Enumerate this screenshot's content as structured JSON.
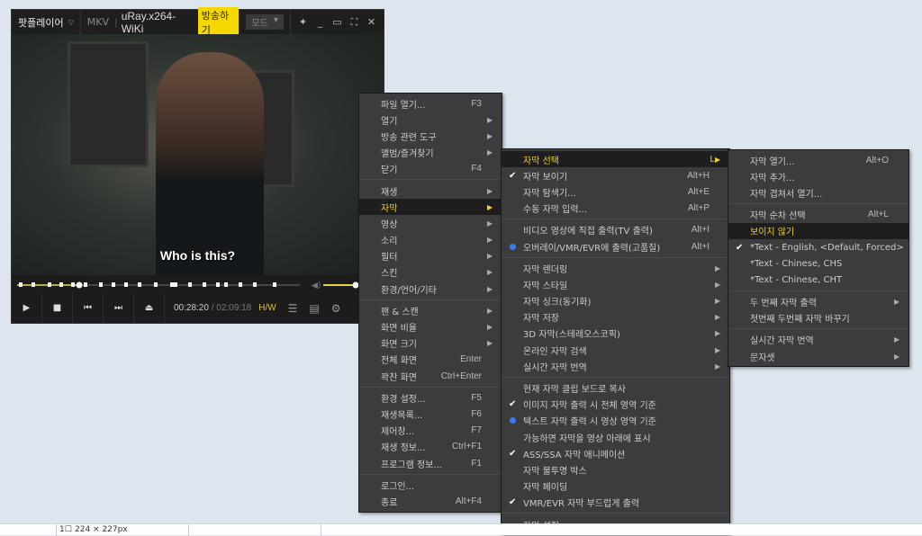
{
  "player": {
    "app_name": "팟플레이어",
    "format": "MKV",
    "file_name": "uRay.x264-WiKi",
    "broadcast_label": "방송하기",
    "mode_label": "모드",
    "subtitle_text": "Who is this?",
    "time_current": "00:28:20",
    "time_separator": "/",
    "time_total": "02:09:18",
    "hw_label": "H/W",
    "progress": 0.22,
    "volume": 1.0
  },
  "menu_main": [
    {
      "label": "파일 열기...",
      "shortcut": "F3"
    },
    {
      "label": "열기",
      "submenu": true
    },
    {
      "label": "방송 관련 도구",
      "submenu": true
    },
    {
      "label": "앨범/즐겨찾기",
      "submenu": true
    },
    {
      "label": "닫기",
      "shortcut": "F4"
    },
    {
      "sep": true
    },
    {
      "label": "재생",
      "submenu": true
    },
    {
      "label": "자막",
      "submenu": true,
      "selected": true
    },
    {
      "label": "영상",
      "submenu": true
    },
    {
      "label": "소리",
      "submenu": true
    },
    {
      "label": "필터",
      "submenu": true
    },
    {
      "label": "스킨",
      "submenu": true
    },
    {
      "label": "환경/언어/기타",
      "submenu": true
    },
    {
      "sep": true
    },
    {
      "label": "팬 & 스캔",
      "submenu": true
    },
    {
      "label": "화면 비율",
      "submenu": true
    },
    {
      "label": "화면 크기",
      "submenu": true
    },
    {
      "label": "전체 화면",
      "shortcut": "Enter"
    },
    {
      "label": "꽉찬 화면",
      "shortcut": "Ctrl+Enter"
    },
    {
      "sep": true
    },
    {
      "label": "환경 설정...",
      "shortcut": "F5"
    },
    {
      "label": "재생목록...",
      "shortcut": "F6"
    },
    {
      "label": "제어창...",
      "shortcut": "F7"
    },
    {
      "label": "재생 정보...",
      "shortcut": "Ctrl+F1"
    },
    {
      "label": "프로그램 정보...",
      "shortcut": "F1"
    },
    {
      "sep": true
    },
    {
      "label": "로그인..."
    },
    {
      "label": "종료",
      "shortcut": "Alt+F4"
    }
  ],
  "menu_subtitle": [
    {
      "label": "자막 선택",
      "shortcut": "L",
      "submenu": true,
      "selected": true
    },
    {
      "label": "자막 보이기",
      "shortcut": "Alt+H",
      "check": true
    },
    {
      "label": "자막 탐색기...",
      "shortcut": "Alt+E"
    },
    {
      "label": "수동 자막 입력...",
      "shortcut": "Alt+P"
    },
    {
      "sep": true
    },
    {
      "label": "비디오 영상에 직접 출력(TV 출력)",
      "shortcut": "Alt+I"
    },
    {
      "label": "오버레이/VMR/EVR에 출력(고품질)",
      "shortcut": "Alt+I",
      "radio": true
    },
    {
      "sep": true
    },
    {
      "label": "자막 렌더링",
      "submenu": true
    },
    {
      "label": "자막 스타일",
      "submenu": true
    },
    {
      "label": "자막 싱크(동기화)",
      "submenu": true
    },
    {
      "label": "자막 저장",
      "submenu": true
    },
    {
      "label": "3D 자막(스테레오스코픽)",
      "submenu": true
    },
    {
      "label": "온라인 자막 검색",
      "submenu": true
    },
    {
      "label": "실시간 자막 번역",
      "submenu": true
    },
    {
      "sep": true
    },
    {
      "label": "현재 자막 클립 보드로 복사"
    },
    {
      "label": "이미지 자막 출력 시 전체 영역 기준",
      "check": true
    },
    {
      "label": "텍스트 자막 출력 시 영상 영역 기준",
      "radio": true
    },
    {
      "label": "가능하면 자막을 영상 아래에 표시"
    },
    {
      "label": "ASS/SSA 자막 애니메이션",
      "check": true
    },
    {
      "label": "자막 불투명 박스"
    },
    {
      "label": "자막 페이딩"
    },
    {
      "label": "VMR/EVR 자막 부드럽게 출력",
      "check": true
    },
    {
      "sep": true
    },
    {
      "label": "자막 설정..."
    }
  ],
  "menu_select": [
    {
      "label": "자막 열기...",
      "shortcut": "Alt+O"
    },
    {
      "label": "자막 추가..."
    },
    {
      "label": "자막 겹쳐서 열기..."
    },
    {
      "sep": true
    },
    {
      "label": "자막 순차 선택",
      "shortcut": "Alt+L"
    },
    {
      "label": "보이지 않기",
      "selected": true
    },
    {
      "label": "*Text - English, <Default, Forced>",
      "check": true
    },
    {
      "label": "*Text - Chinese, CHS"
    },
    {
      "label": "*Text - Chinese, CHT"
    },
    {
      "sep": true
    },
    {
      "label": "두 번째 자막 출력",
      "submenu": true
    },
    {
      "label": "첫번째 두번째 자막 바꾸기"
    },
    {
      "sep": true
    },
    {
      "label": "실시간 자막 번역",
      "submenu": true
    },
    {
      "label": "문자셋",
      "submenu": true
    }
  ],
  "statusbar": {
    "dimensions": "224 × 227px"
  }
}
